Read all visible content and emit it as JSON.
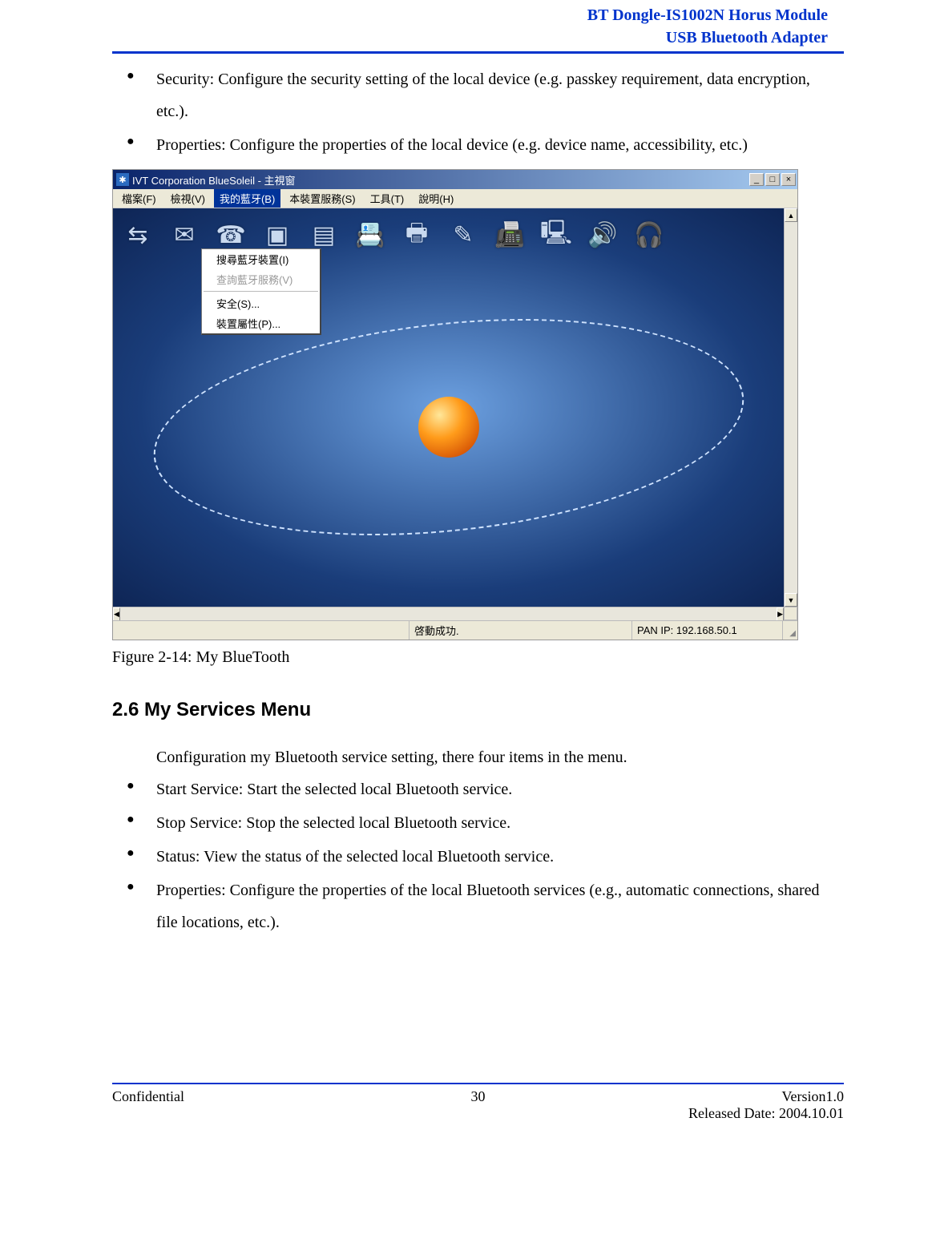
{
  "header": {
    "line1": "BT Dongle-IS1002N Horus Module",
    "line2": "USB Bluetooth Adapter"
  },
  "topBullets": {
    "item1": "Security: Configure the security setting of the local device (e.g. passkey requirement, data encryption, etc.).",
    "item2": "Properties: Configure the properties of the local device (e.g. device name, accessibility, etc.)"
  },
  "screenshot": {
    "title": "IVT Corporation BlueSoleil - 主視窗",
    "menubar": {
      "file": "檔案(F)",
      "view": "檢視(V)",
      "mybt": "我的藍牙(B)",
      "svc": "本裝置服務(S)",
      "tools": "工具(T)",
      "help": "說明(H)"
    },
    "dropdown": {
      "search": "搜尋藍牙裝置(I)",
      "query": "查詢藍牙服務(V)",
      "security": "安全(S)...",
      "props": "裝置屬性(P)..."
    },
    "statusbar": {
      "status": "啓動成功.",
      "panip": "PAN IP: 192.168.50.1"
    },
    "winbtn": {
      "min": "_",
      "max": "□",
      "close": "×"
    }
  },
  "caption": {
    "label": "Figure 2-14:",
    "text": " My BlueTooth"
  },
  "section26": {
    "heading": "2.6    My Services Menu",
    "intro": "Configuration my Bluetooth service setting, there four items in the menu.",
    "items": {
      "b1": "Start Service: Start the selected local Bluetooth service.",
      "b2": "Stop Service: Stop the selected local Bluetooth service.",
      "b3": "Status: View the status of the selected local Bluetooth service.",
      "b4": "Properties: Configure the properties of the local Bluetooth services (e.g., automatic connections, shared file locations, etc.)."
    }
  },
  "footer": {
    "left": "Confidential",
    "page": "30",
    "version": "Version1.0",
    "released": "Released Date: 2004.10.01"
  }
}
